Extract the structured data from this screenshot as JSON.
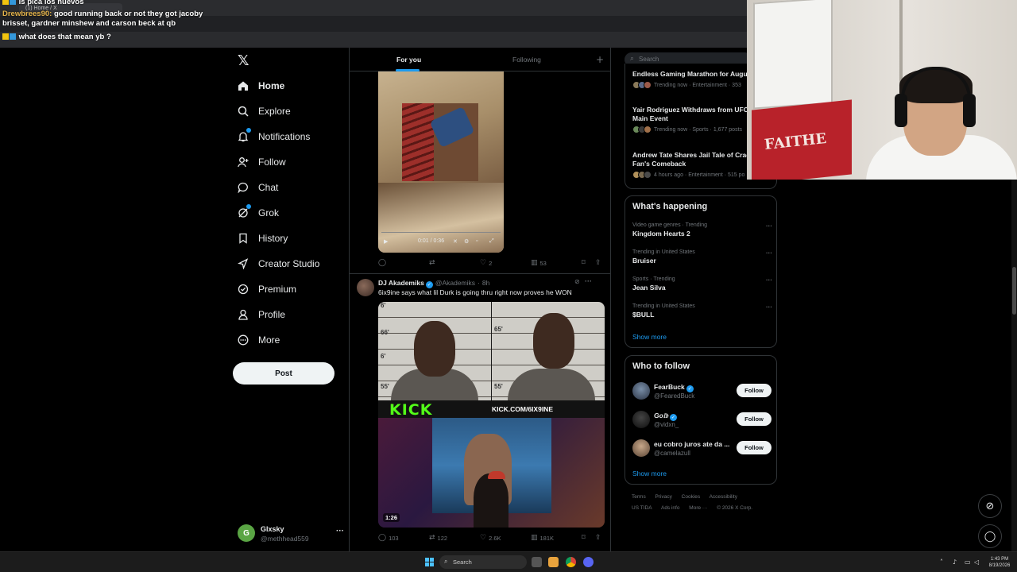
{
  "chat": {
    "line0_user": "",
    "line0_text": "is pica los huevos",
    "line1_user": "Drewbrees90:",
    "line1_text": "good running back or not they got jacoby",
    "line1b_text": "brisset, gardner minshew and carson beck at qb",
    "line2_user": "",
    "line2_text": "what does that mean yb ?"
  },
  "browser": {
    "tab_title": "(1) Home / X"
  },
  "nav": {
    "logo": "𝕏",
    "items": [
      {
        "label": "Home"
      },
      {
        "label": "Explore"
      },
      {
        "label": "Notifications"
      },
      {
        "label": "Follow"
      },
      {
        "label": "Chat"
      },
      {
        "label": "Grok"
      },
      {
        "label": "History"
      },
      {
        "label": "Creator Studio"
      },
      {
        "label": "Premium"
      },
      {
        "label": "Profile"
      },
      {
        "label": "More"
      }
    ],
    "post_label": "Post",
    "account": {
      "initial": "G",
      "name": "Glxsky",
      "handle": "@methhead559",
      "menu": "···"
    }
  },
  "timeline": {
    "tabs": {
      "for_you": "For you",
      "following": "Following",
      "add": "+"
    },
    "post1": {
      "video_time": "0:01 / 0:36",
      "reply_count": "",
      "repost_count": "",
      "like_count": "2",
      "view_count": "53"
    },
    "post2": {
      "author": "DJ Akademiks",
      "handle": "@Akademiks",
      "time": "8h",
      "text": "6ix9ine says what lil Durk is going thru right now proves he WON",
      "kick_logo": "KICK",
      "kick_url": "KICK.COM/6IX9INE",
      "duration": "1:26",
      "reply_count": "103",
      "repost_count": "122",
      "like_count": "2.6K",
      "view_count": "181K",
      "mug_labels": [
        "6'",
        "66'",
        "6'",
        "55'",
        "65'",
        "55'"
      ]
    }
  },
  "right": {
    "search_placeholder": "Search",
    "news": [
      {
        "headline": "Endless Gaming Marathon for August",
        "meta": "Trending now · Entertainment · 353"
      },
      {
        "headline": "Yair Rodriguez Withdraws from UFC",
        "headline2": "Main Event",
        "meta": "Trending now · Sports · 1,677 posts"
      },
      {
        "headline": "Andrew Tate Shares Jail Tale of Crack",
        "headline2": "Fan's Comeback",
        "meta": "4 hours ago · Entertainment · 515 po"
      }
    ],
    "happening": {
      "title": "What's happening",
      "trends": [
        {
          "context": "Video game genres · Trending",
          "name": "Kingdom Hearts 2"
        },
        {
          "context": "Trending in United States",
          "name": "Bruiser"
        },
        {
          "context": "Sports · Trending",
          "name": "Jean Silva"
        },
        {
          "context": "Trending in United States",
          "name": "$BULL"
        }
      ],
      "show_more": "Show more"
    },
    "who_to_follow": {
      "title": "Who to follow",
      "accounts": [
        {
          "name": "FearBuck",
          "handle": "@FearedBuck",
          "button": "Follow"
        },
        {
          "name": "Go𝔩𝔡",
          "handle": "@vidxn_",
          "button": "Follow"
        },
        {
          "name": "eu cobro juros ate da ...",
          "handle": "@camelazull",
          "button": "Follow"
        }
      ],
      "show_more": "Show more"
    },
    "footer": {
      "row1": [
        "Terms",
        "Privacy",
        "Cookies",
        "Accessibility"
      ],
      "row2": [
        "US TIDA",
        "Ads info",
        "More ···",
        "© 2026 X Corp."
      ]
    }
  },
  "webcam": {
    "shirt_text": "FAITHE"
  },
  "taskbar": {
    "search_label": "Search",
    "time": "1:43 PM",
    "date": "8/19/2026"
  },
  "colors": {
    "accent": "#1d9bf0",
    "background": "#000000",
    "kick_green": "#53fc18"
  },
  "icons": [
    "x-logo",
    "home-icon",
    "search-icon",
    "bell-icon",
    "add-user-icon",
    "chat-bubble-icon",
    "grok-icon",
    "bookmark-icon",
    "lightning-icon",
    "verified-icon",
    "person-icon",
    "more-circle-icon"
  ]
}
